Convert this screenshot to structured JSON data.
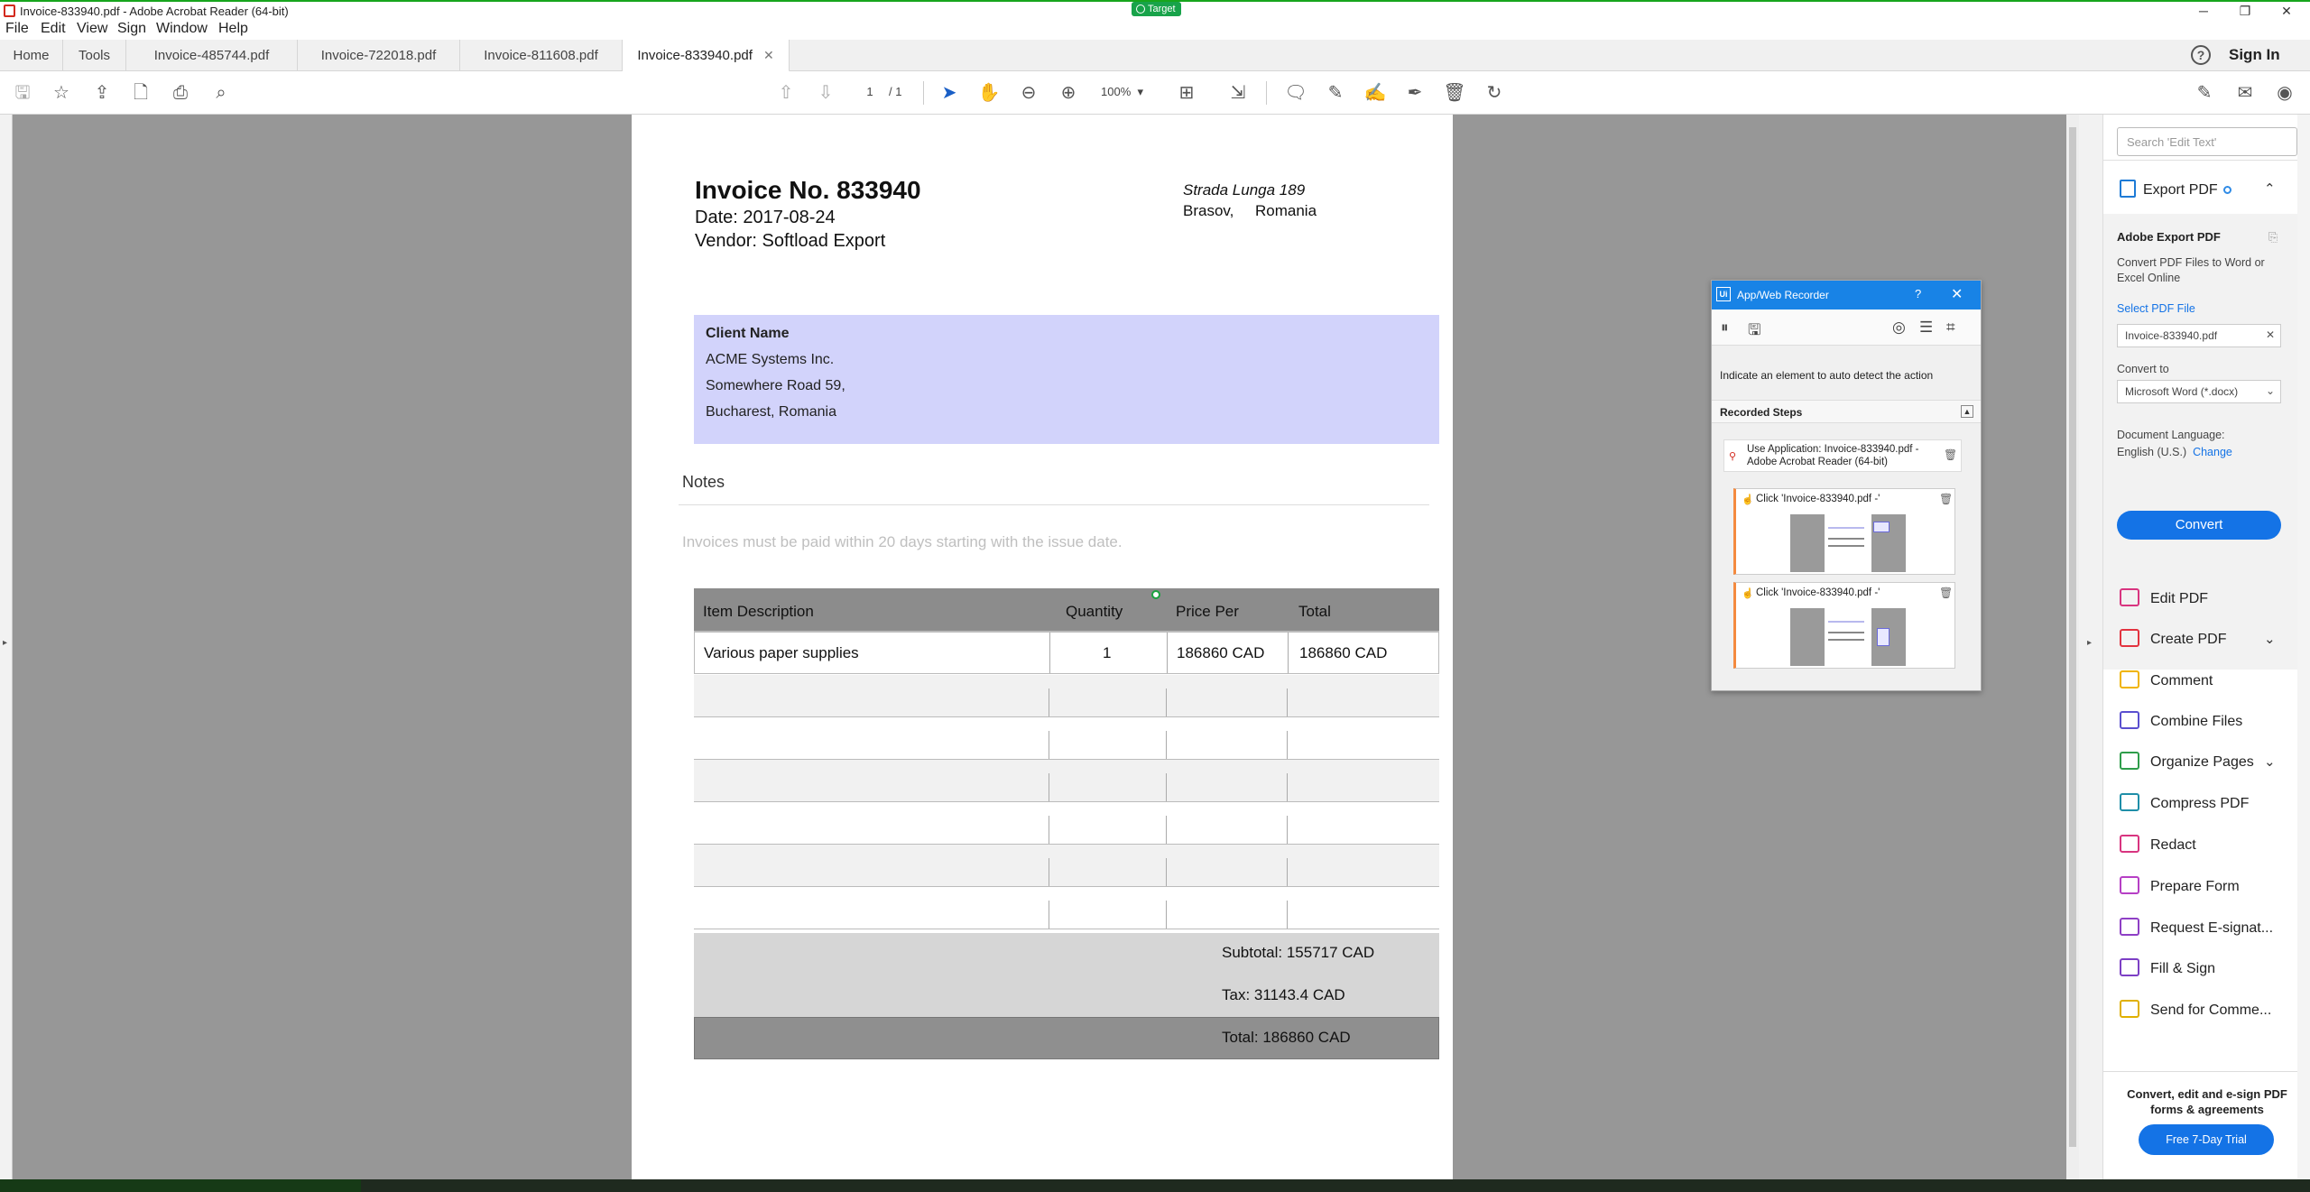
{
  "window": {
    "title": "Invoice-833940.pdf - Adobe Acrobat Reader (64-bit)",
    "target_badge": "Target",
    "controls": [
      "─",
      "❐",
      "✕"
    ]
  },
  "menu": [
    "File",
    "Edit",
    "View",
    "Sign",
    "Window",
    "Help"
  ],
  "tabs": {
    "home": "Home",
    "tools": "Tools",
    "files": [
      "Invoice-485744.pdf",
      "Invoice-722018.pdf",
      "Invoice-811608.pdf",
      "Invoice-833940.pdf"
    ],
    "active_index": 3,
    "help": "?",
    "sign_in": "Sign In"
  },
  "toolbar": {
    "page_current": "1",
    "page_of": "/ 1",
    "zoom": "100%"
  },
  "invoice": {
    "title": "Invoice No. 833940",
    "date": "Date: 2017-08-24",
    "vendor": "Vendor: Softload Export",
    "address_line1": "Strada Lunga 189",
    "address_line2": "Brasov,     Romania",
    "client": {
      "heading": "Client Name",
      "name": "ACME Systems Inc.",
      "street": "Somewhere Road 59,",
      "city": "Bucharest, Romania"
    },
    "notes_heading": "Notes",
    "notes_text": "Invoices must be paid within 20 days starting with the issue date.",
    "table": {
      "headers": [
        "Item Description",
        "Quantity",
        "Price Per",
        "Total"
      ],
      "rows": [
        [
          "Various paper supplies",
          "1",
          "186860 CAD",
          "186860 CAD"
        ]
      ],
      "empty_rows": 6
    },
    "subtotal": "Subtotal: 155717 CAD",
    "tax": "Tax: 31143.4 CAD",
    "total": "Total: 186860 CAD"
  },
  "recorder": {
    "title": "App/Web Recorder",
    "help": "?",
    "hint": "Indicate an element to auto detect the action",
    "steps_heading": "Recorded Steps",
    "app_step": "Use Application: Invoice-833940.pdf - Adobe Acrobat Reader (64-bit)",
    "click_steps": [
      "Click 'Invoice-833940.pdf -'",
      "Click 'Invoice-833940.pdf -'"
    ]
  },
  "right_pane": {
    "search_placeholder": "Search 'Edit Text'",
    "export_title": "Export PDF",
    "export_heading": "Adobe Export PDF",
    "export_desc": "Convert PDF Files to Word or Excel Online",
    "select_file": "Select PDF File",
    "file_name": "Invoice-833940.pdf",
    "convert_to_label": "Convert to",
    "convert_to_value": "Microsoft Word (*.docx)",
    "language_label": "Document Language:",
    "language_value": "English (U.S.)",
    "change": "Change",
    "convert_button": "Convert",
    "tools": [
      {
        "label": "Edit PDF",
        "color": "#d8347f"
      },
      {
        "label": "Create PDF",
        "color": "#e3333f"
      },
      {
        "label": "Comment",
        "color": "#f0b400"
      },
      {
        "label": "Combine Files",
        "color": "#5a4fcf"
      },
      {
        "label": "Organize Pages",
        "color": "#2e9d4a"
      },
      {
        "label": "Compress PDF",
        "color": "#1f8ea8"
      },
      {
        "label": "Redact",
        "color": "#d8347f"
      },
      {
        "label": "Prepare Form",
        "color": "#b63fc5"
      },
      {
        "label": "Request E-signat...",
        "color": "#8e3fc5"
      },
      {
        "label": "Fill & Sign",
        "color": "#7c3fc5"
      },
      {
        "label": "Send for Comme...",
        "color": "#e0b000"
      }
    ],
    "promo_text": "Convert, edit and e-sign PDF forms & agreements",
    "trial_button": "Free 7-Day Trial"
  }
}
